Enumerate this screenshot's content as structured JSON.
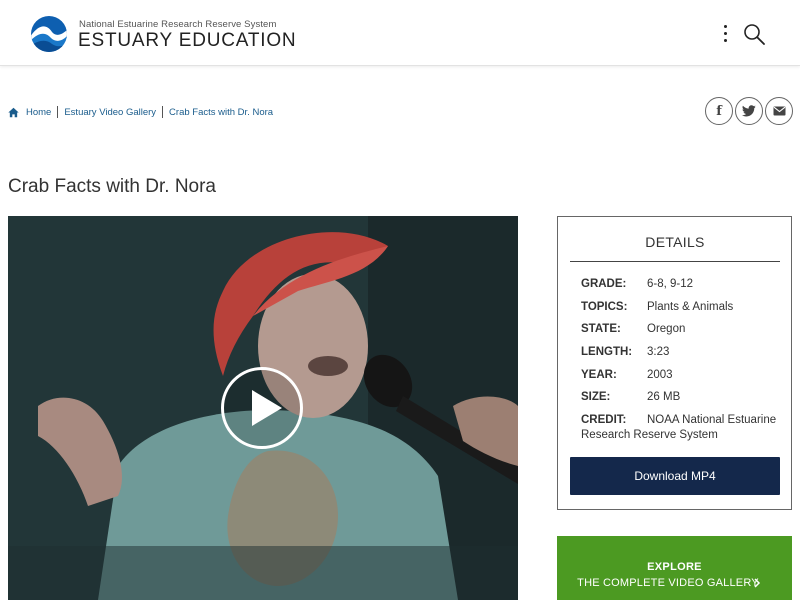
{
  "header": {
    "org_name": "National Estuarine Research Reserve System",
    "site_title": "ESTUARY EDUCATION",
    "icons": {
      "logo": "noaa-logo",
      "menu": "kebab-menu-icon",
      "search": "search-icon"
    }
  },
  "breadcrumb": {
    "items": [
      {
        "label": "Home"
      },
      {
        "label": "Estuary Video Gallery"
      },
      {
        "label": "Crab Facts with Dr. Nora"
      }
    ]
  },
  "share": {
    "items": [
      {
        "icon": "facebook-icon",
        "glyph": "f"
      },
      {
        "icon": "twitter-icon"
      },
      {
        "icon": "email-icon"
      }
    ]
  },
  "page": {
    "title": "Crab Facts with Dr. Nora"
  },
  "video": {
    "play_icon": "play-icon"
  },
  "details": {
    "title": "DETAILS",
    "rows": [
      {
        "label": "GRADE:",
        "value": "6-8, 9-12"
      },
      {
        "label": "TOPICS:",
        "value": "Plants & Animals"
      },
      {
        "label": "STATE:",
        "value": "Oregon"
      },
      {
        "label": "LENGTH:",
        "value": "3:23"
      },
      {
        "label": "YEAR:",
        "value": "2003"
      },
      {
        "label": "SIZE:",
        "value": "26 MB"
      },
      {
        "label": "CREDIT:",
        "value": "NOAA National Estuarine",
        "value_line2": "Research Reserve System"
      }
    ],
    "download_label": "Download MP4"
  },
  "explore": {
    "line1": "EXPLORE",
    "line2": "THE COMPLETE VIDEO GALLERY"
  },
  "colors": {
    "link": "#1a5c8c",
    "download_bg": "#14284b",
    "explore_bg": "#4c9a22",
    "logo_blue": "#0e5fb0"
  }
}
